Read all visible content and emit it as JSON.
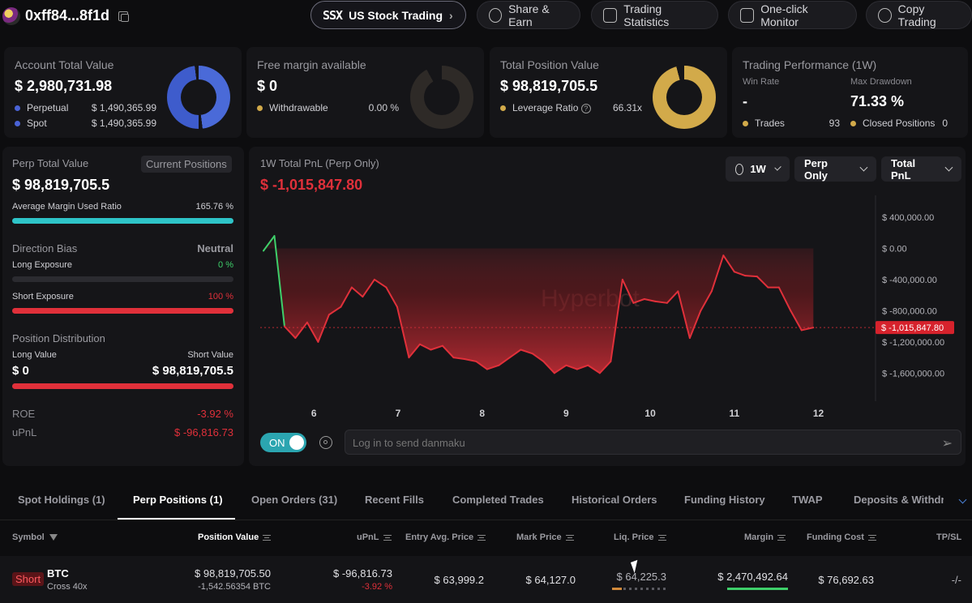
{
  "header": {
    "address": "0xff84...8f1d",
    "us_stock_label": "US Stock Trading",
    "us_stock_logo": "SSX",
    "share_label": "Share & Earn",
    "stats_label": "Trading Statistics",
    "monitor_label": "One-click Monitor",
    "copy_label": "Copy Trading"
  },
  "account": {
    "title": "Account Total Value",
    "value": "$ 2,980,731.98",
    "perpetual_label": "Perpetual",
    "perpetual_value": "$ 1,490,365.99",
    "spot_label": "Spot",
    "spot_value": "$ 1,490,365.99"
  },
  "margin": {
    "title": "Free margin available",
    "value": "$ 0",
    "withdrawable_label": "Withdrawable",
    "withdrawable_value": "0.00 %"
  },
  "position": {
    "title": "Total Position Value",
    "value": "$ 98,819,705.5",
    "leverage_label": "Leverage Ratio",
    "leverage_value": "66.31x"
  },
  "performance": {
    "title": "Trading Performance (1W)",
    "win_rate_label": "Win Rate",
    "win_rate_value": "-",
    "drawdown_label": "Max Drawdown",
    "drawdown_value": "71.33 %",
    "trades_label": "Trades",
    "trades_value": "93",
    "closed_label": "Closed Positions",
    "closed_value": "0"
  },
  "perp": {
    "title": "Perp Total Value",
    "current_positions": "Current Positions",
    "value": "$ 98,819,705.5",
    "avg_margin_label": "Average Margin Used Ratio",
    "avg_margin_value": "165.76 %",
    "avg_margin_fill": 1.0,
    "direction_label": "Direction Bias",
    "direction_value": "Neutral",
    "long_exposure_label": "Long Exposure",
    "long_exposure_value": "0 %",
    "long_exposure_fill": 0,
    "short_exposure_label": "Short Exposure",
    "short_exposure_value": "100 %",
    "short_exposure_fill": 1.0,
    "distribution_label": "Position Distribution",
    "long_value_label": "Long Value",
    "long_value": "$ 0",
    "short_value_label": "Short Value",
    "short_value": "$ 98,819,705.5",
    "short_value_fill": 1.0,
    "roe_label": "ROE",
    "roe_value": "-3.92 %",
    "upnl_label": "uPnL",
    "upnl_value": "$ -96,816.73"
  },
  "chart_panel": {
    "title": "1W Total PnL (Perp Only)",
    "value": "$ -1,015,847.80",
    "range_label": "1W",
    "filter_label": "Perp Only",
    "metric_label": "Total PnL",
    "watermark": "Hyperbot",
    "toggle_label": "ON",
    "danmaku_placeholder": "Log in to send danmaku"
  },
  "chart_data": {
    "type": "area",
    "title": "1W Total PnL (Perp Only)",
    "xlabel": "",
    "ylabel": "",
    "x_ticks": [
      "6",
      "7",
      "8",
      "9",
      "10",
      "11",
      "12"
    ],
    "y_ticks": [
      "$ 400,000.00",
      "$ 0.00",
      "$ -400,000.00",
      "$ -800,000.00",
      "$ -1,200,000.00",
      "$ -1,600,000.00"
    ],
    "y_tick_values": [
      400000,
      0,
      -400000,
      -800000,
      -1200000,
      -1600000
    ],
    "ylim": [
      -1950000,
      650000
    ],
    "current_value": -1015847.8,
    "current_label": "$ -1,015,847.80",
    "x": [
      5.4,
      5.53,
      5.65,
      5.78,
      5.92,
      6.05,
      6.18,
      6.32,
      6.45,
      6.58,
      6.72,
      6.86,
      6.99,
      7.13,
      7.26,
      7.39,
      7.53,
      7.66,
      7.79,
      7.93,
      8.06,
      8.2,
      8.33,
      8.46,
      8.6,
      8.73,
      8.86,
      9.0,
      9.13,
      9.26,
      9.4,
      9.53,
      9.67,
      9.8,
      9.93,
      10.06,
      10.2,
      10.33,
      10.47,
      10.6,
      10.73,
      10.87,
      11.0,
      11.13,
      11.27,
      11.4,
      11.53,
      11.67,
      11.8,
      11.94,
      12.07,
      12.2,
      12.34,
      12.47,
      12.6,
      12.66
    ],
    "values": [
      -30000,
      160000,
      -1000000,
      -1150000,
      -950000,
      -1200000,
      -850000,
      -750000,
      -500000,
      -620000,
      -400000,
      -500000,
      -750000,
      -1400000,
      -1230000,
      -1300000,
      -1250000,
      -1400000,
      -1420000,
      -1450000,
      -1550000,
      -1500000,
      -1400000,
      -1300000,
      -1350000,
      -1450000,
      -1600000,
      -1500000,
      -1550000,
      -1500000,
      -1600000,
      -1450000,
      -400000,
      -700000,
      -650000,
      -680000,
      -700000,
      -550000,
      -1150000,
      -800000,
      -550000,
      -90000,
      -300000,
      -350000,
      -360000,
      -500000,
      -500000,
      -800000,
      -1050000,
      -1015847
    ]
  },
  "tabs": {
    "spot": "Spot Holdings (1)",
    "perp": "Perp Positions (1)",
    "orders": "Open Orders (31)",
    "fills": "Recent Fills",
    "completed": "Completed Trades",
    "historical": "Historical Orders",
    "funding": "Funding History",
    "twap": "TWAP",
    "deposits": "Deposits & Withdra"
  },
  "table": {
    "headers": {
      "symbol": "Symbol",
      "position_value": "Position Value",
      "upnl": "uPnL",
      "entry": "Entry Avg. Price",
      "mark": "Mark Price",
      "liq": "Liq. Price",
      "margin": "Margin",
      "funding": "Funding Cost",
      "tpsl": "TP/SL"
    },
    "rows": [
      {
        "side": "Short",
        "symbol": "BTC",
        "cross": "Cross 40x",
        "position_value": "$ 98,819,705.50",
        "position_size": "-1,542.56354 BTC",
        "upnl": "$ -96,816.73",
        "upnl_pct": "-3.92 %",
        "entry": "$ 63,999.2",
        "mark": "$ 64,127.0",
        "liq": "$ 64,225.3",
        "margin": "$ 2,470,492.64",
        "funding": "$ 76,692.63",
        "tpsl": "-/-"
      }
    ]
  },
  "colors": {
    "accent_blue": "#4a63d6",
    "accent_teal": "#2ec4c8",
    "gold": "#d2aa4a",
    "red": "#e0303a",
    "green": "#3ecf6a"
  }
}
